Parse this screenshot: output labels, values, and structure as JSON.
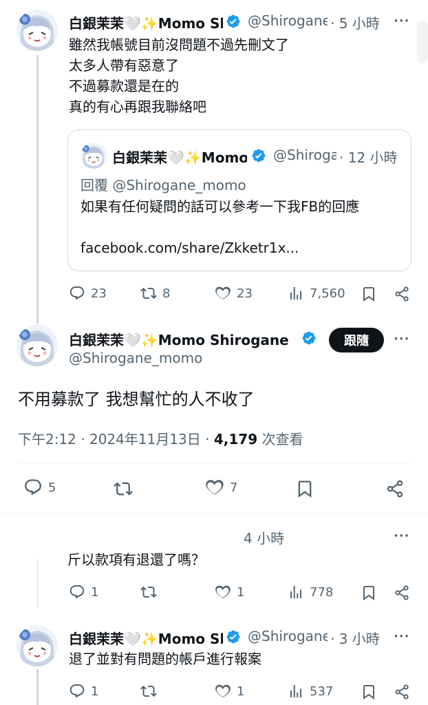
{
  "tweet1": {
    "display_name": "白銀茉茉🤍✨Momo Shirogane",
    "handle": "@Shirogane_momo",
    "time": "· 5 小時",
    "more": "···",
    "lines": [
      "雖然我帳號目前沒問題不過先刪文了",
      "太多人帶有惡意了",
      "不過募款還是在的",
      "真的有心再跟我聯絡吧"
    ],
    "quote": {
      "display_name": "白銀茉茉🤍✨Momo Shirogane",
      "handle": "@Shirogane_momo",
      "time": "· 12 小時",
      "reply_to": "回覆 @Shirogane_momo",
      "text": "如果有任何疑問的話可以參考一下我FB的回應",
      "link": "facebook.com/share/Zkketr1x..."
    },
    "actions": {
      "replies": "23",
      "reposts": "8",
      "likes": "23",
      "views": "7,560"
    }
  },
  "main_tweet": {
    "display_name": "白銀茉茉🤍✨Momo Shirogane",
    "handle": "@Shirogane_momo",
    "follow_label": "跟隨",
    "more": "···",
    "text": "不用募款了 我想幫忙的人不收了",
    "time": "下午2:12 · 2024年11月13日 · ",
    "views_count": "4,179",
    "views_label": " 次查看",
    "actions": {
      "replies": "5",
      "likes": "7"
    }
  },
  "reply1": {
    "time": "4 小時",
    "more": "···",
    "text": "斤以款項有退還了嗎？",
    "actions": {
      "replies": "1",
      "likes": "1",
      "views": "778"
    }
  },
  "reply2": {
    "display_name": "白銀茉茉🤍✨Momo Shirogane",
    "handle": "@Shirogane_momo",
    "time": "· 3 小時",
    "more": "···",
    "text": "退了並對有問題的帳戶進行報案",
    "actions": {
      "replies": "1",
      "likes": "1",
      "views": "537"
    }
  },
  "colors": {
    "accent": "#1d9bf0",
    "text": "#0f1419",
    "muted": "#536471"
  }
}
